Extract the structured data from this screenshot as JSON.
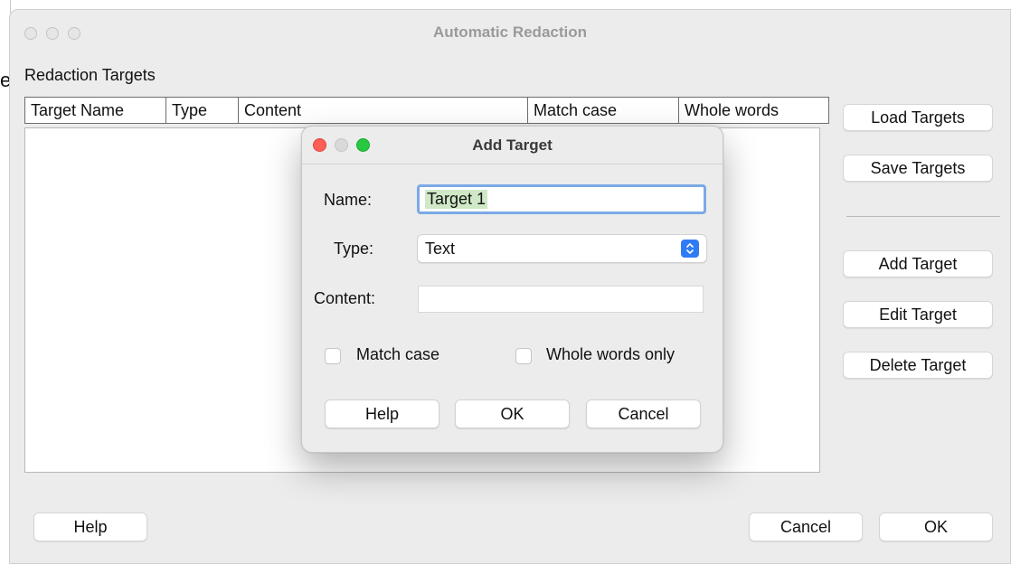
{
  "main_window": {
    "title": "Automatic Redaction",
    "section_label": "Redaction Targets",
    "columns": [
      "Target Name",
      "Type",
      "Content",
      "Match case",
      "Whole words"
    ],
    "side_buttons": {
      "load": "Load Targets",
      "save": "Save Targets",
      "add": "Add Target",
      "edit": "Edit Target",
      "delete": "Delete Target"
    },
    "bottom_buttons": {
      "help": "Help",
      "cancel": "Cancel",
      "ok": "OK"
    }
  },
  "background": {
    "glyph": "e"
  },
  "dialog": {
    "title": "Add Target",
    "name_label": "Name:",
    "name_value": "Target 1",
    "type_label": "Type:",
    "type_value": "Text",
    "content_label": "Content:",
    "content_value": "",
    "match_case_label": "Match case",
    "match_case_checked": false,
    "whole_words_label": "Whole words only",
    "whole_words_checked": false,
    "buttons": {
      "help": "Help",
      "ok": "OK",
      "cancel": "Cancel"
    }
  },
  "colors": {
    "close_light": "#fe5f57",
    "minimize_light": "#d9d9d9",
    "zoom_light": "#28c840",
    "focus_ring": "#7ba9e6",
    "selection_highlight": "#cfe8c6",
    "select_accent": "#2f7bf5"
  },
  "icons": {
    "select_chevrons": "up-down-chevrons-icon"
  }
}
